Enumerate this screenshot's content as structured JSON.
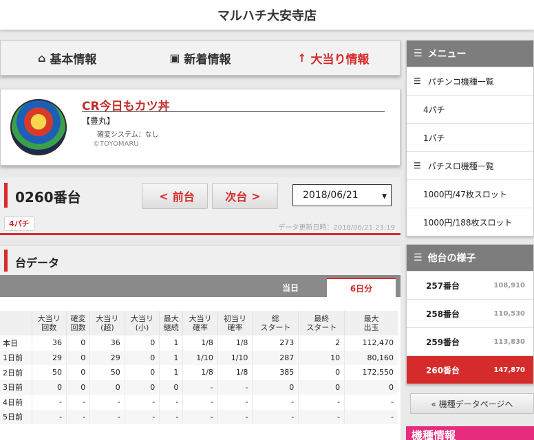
{
  "header": {
    "title": "マルハチ大安寺店"
  },
  "nav": [
    {
      "icon": "home-icon",
      "glyph": "⌂",
      "label": "基本情報",
      "active": false
    },
    {
      "icon": "news-icon",
      "glyph": "▣",
      "label": "新着情報",
      "active": false
    },
    {
      "icon": "arrow-up-icon",
      "glyph": "↑",
      "label": "大当り情報",
      "active": true
    }
  ],
  "machine": {
    "name": "CR今日もカツ丼",
    "maker": "【豊丸】",
    "system": "確変システム：なし",
    "copyright": "©TOYOMARU"
  },
  "unit": {
    "number": "0260番台",
    "prev_label": "前台",
    "next_label": "次台",
    "date": "2018/06/21",
    "tag": "4パチ",
    "updated": "データ更新日時：2018/06/21 23:19"
  },
  "data_section": {
    "title": "台データ",
    "tabs": {
      "today": "当日",
      "six_days": "6日分"
    },
    "headers": [
      [
        "",
        ""
      ],
      [
        "大当リ",
        "回数"
      ],
      [
        "確変",
        "回数"
      ],
      [
        "大当リ",
        "(超)"
      ],
      [
        "大当リ",
        "(小)"
      ],
      [
        "最大",
        "継続"
      ],
      [
        "大当リ",
        "確率"
      ],
      [
        "初当リ",
        "確率"
      ],
      [
        "総",
        "スタート"
      ],
      [
        "最終",
        "スタート"
      ],
      [
        "最大",
        "出玉"
      ]
    ],
    "rows": [
      [
        "本日",
        "36",
        "0",
        "36",
        "0",
        "1",
        "1/8",
        "1/8",
        "273",
        "2",
        "112,470"
      ],
      [
        "1日前",
        "29",
        "0",
        "29",
        "0",
        "1",
        "1/10",
        "1/10",
        "287",
        "10",
        "80,160"
      ],
      [
        "2日前",
        "50",
        "0",
        "50",
        "0",
        "1",
        "1/8",
        "1/8",
        "385",
        "0",
        "172,550"
      ],
      [
        "3日前",
        "0",
        "0",
        "0",
        "0",
        "0",
        "-",
        "-",
        "0",
        "0",
        "0"
      ],
      [
        "4日前",
        "-",
        "-",
        "-",
        "-",
        "-",
        "-",
        "-",
        "-",
        "-",
        "-"
      ],
      [
        "5日前",
        "-",
        "-",
        "-",
        "-",
        "-",
        "-",
        "-",
        "-",
        "-",
        "-"
      ]
    ]
  },
  "menu": {
    "title": "メニュー",
    "items": [
      {
        "type": "cat",
        "label": "パチンコ機種一覧"
      },
      {
        "type": "sub",
        "label": "4パチ"
      },
      {
        "type": "sub",
        "label": "1パチ"
      },
      {
        "type": "cat",
        "label": "パチスロ機種一覧"
      },
      {
        "type": "sub",
        "label": "1000円/47枚スロット"
      },
      {
        "type": "sub",
        "label": "1000円/188枚スロット"
      }
    ]
  },
  "other_units": {
    "title": "他台の様子",
    "items": [
      {
        "label": "257番台",
        "value": "108,910",
        "active": false
      },
      {
        "label": "258番台",
        "value": "110,530",
        "active": false
      },
      {
        "label": "259番台",
        "value": "113,830",
        "active": false
      },
      {
        "label": "260番台",
        "value": "147,870",
        "active": true
      }
    ]
  },
  "back_button": "« 機種データページへ",
  "promo": "機種情報",
  "colors": {
    "accent": "#d62b2b",
    "sidebar_header": "#7d7d7d",
    "tab_bar": "#8a8a8a",
    "promo": "#e62c7d"
  }
}
